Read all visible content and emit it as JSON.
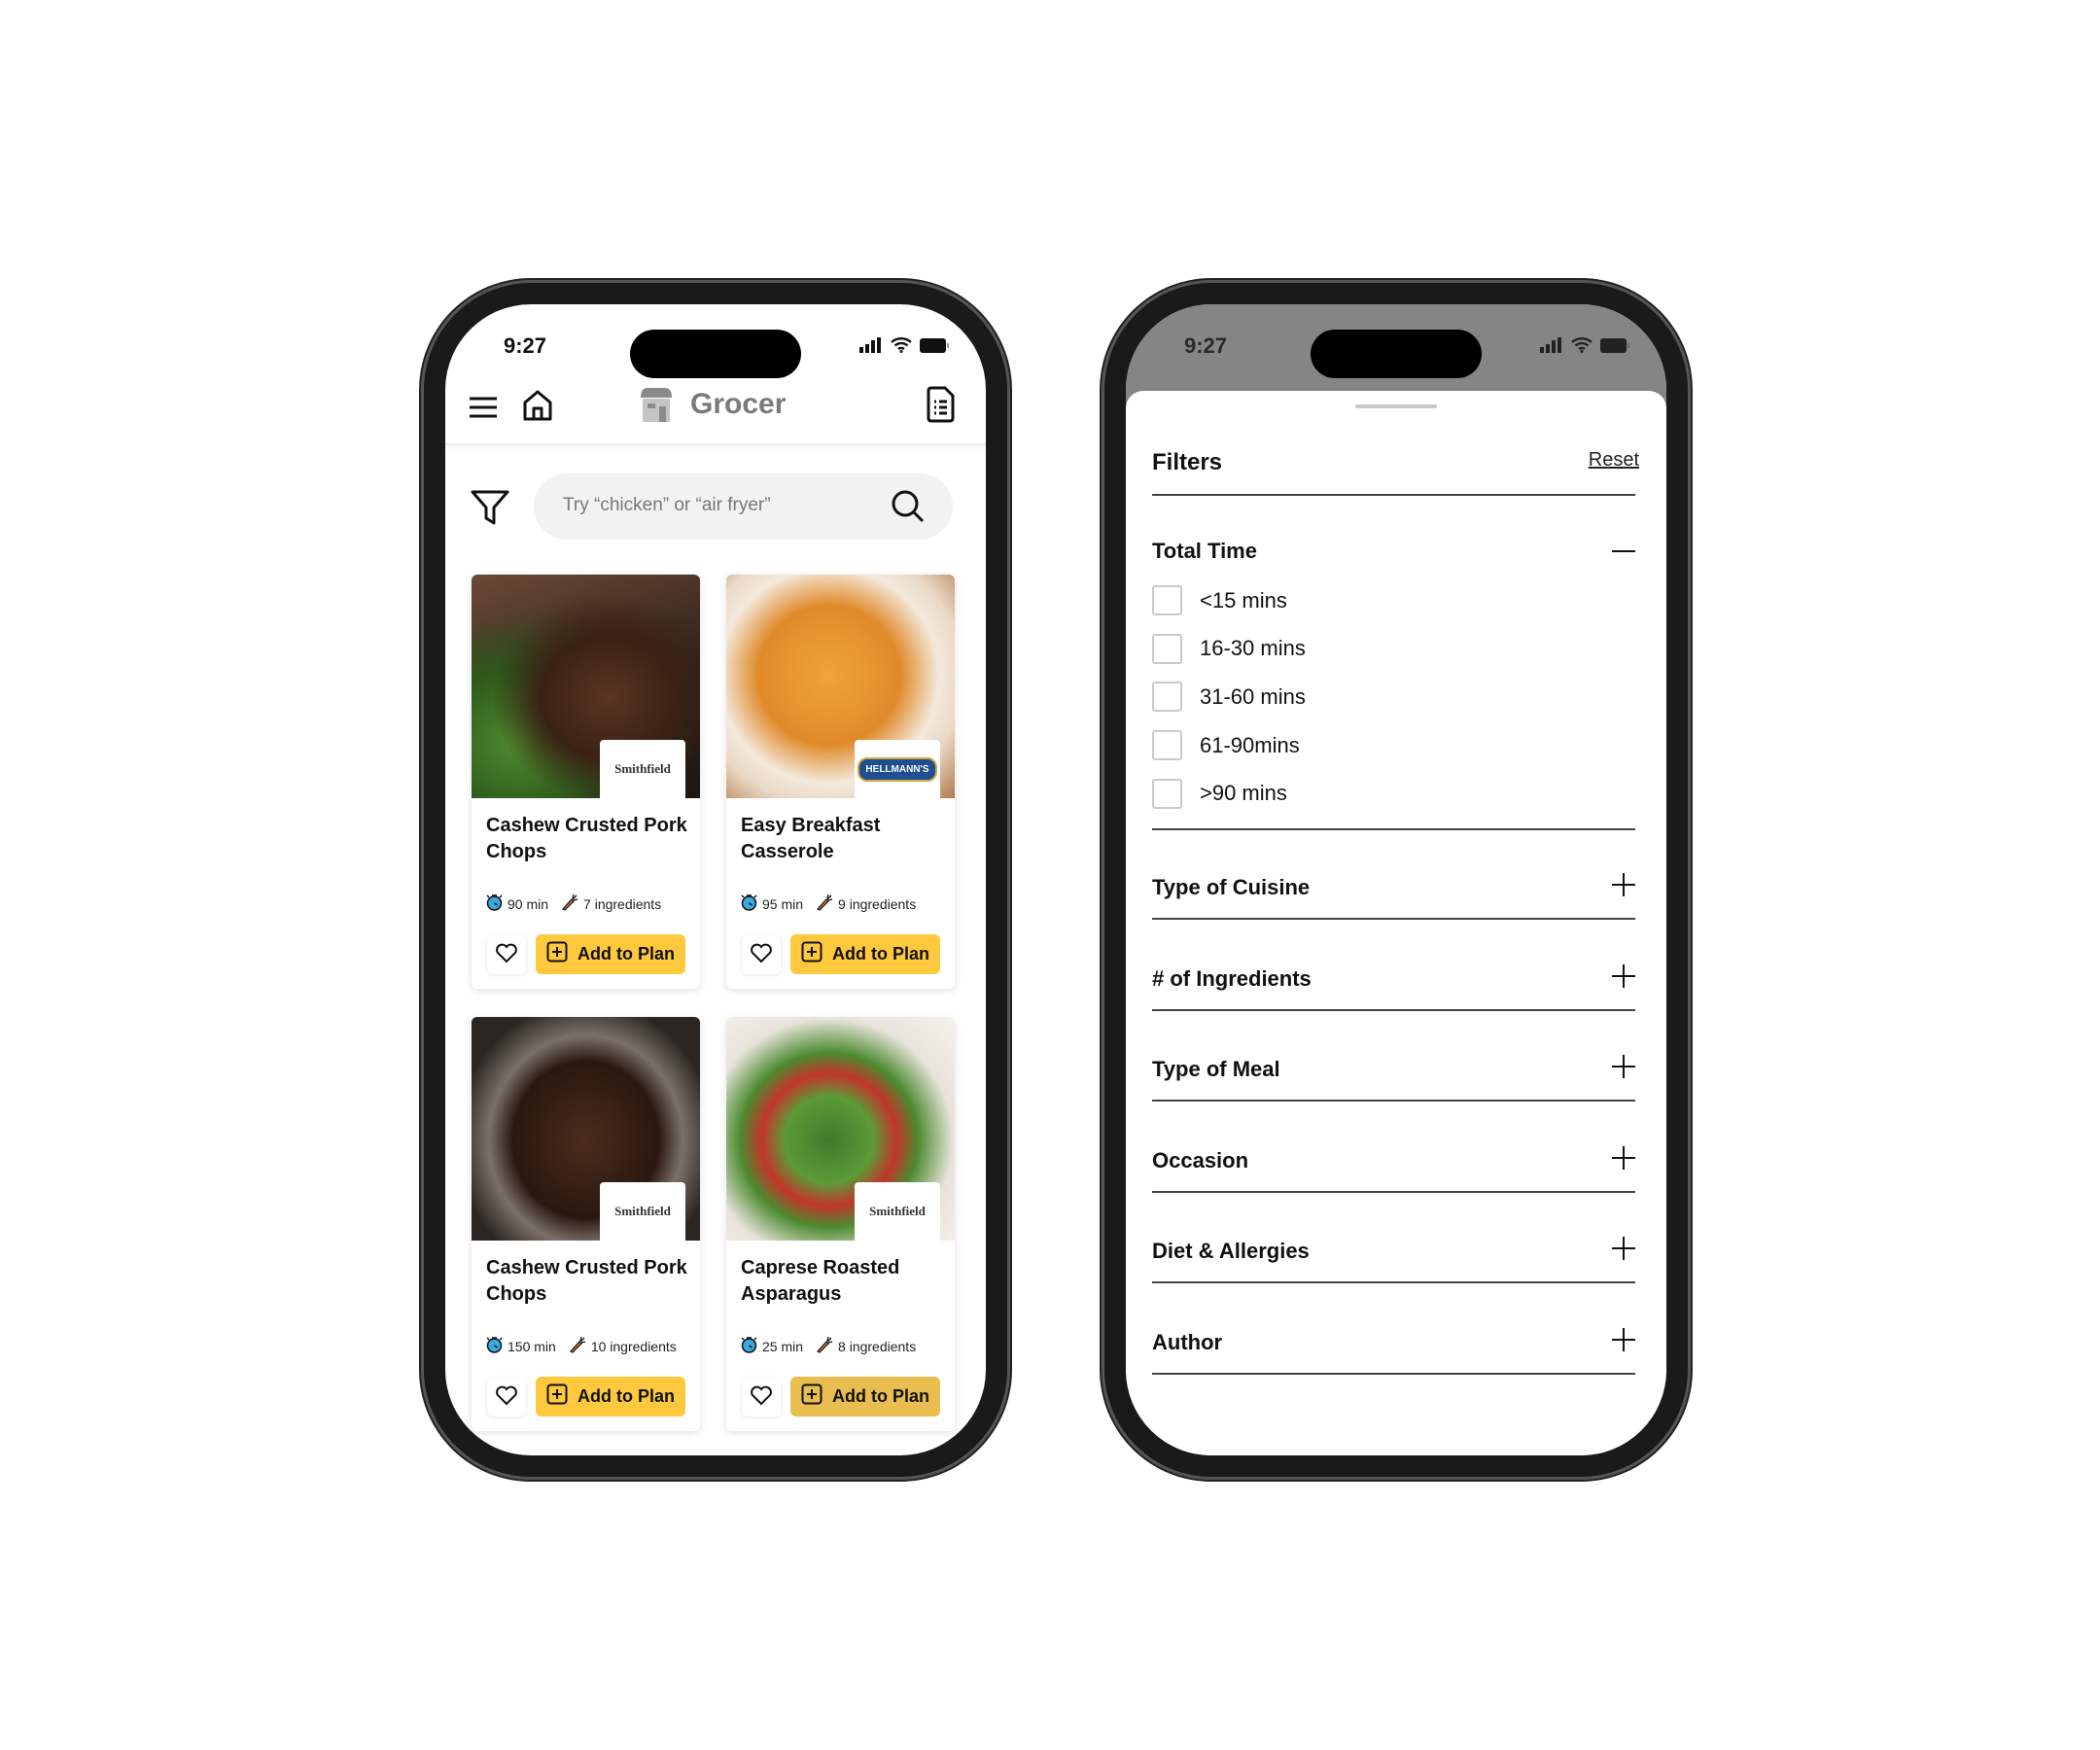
{
  "status": {
    "time": "9:27"
  },
  "app": {
    "name": "Grocer",
    "icons": [
      "hamburger-menu-icon",
      "home-icon",
      "store-logo-icon",
      "list-document-icon"
    ]
  },
  "search": {
    "placeholder": "Try “chicken” or “air fryer”"
  },
  "colors": {
    "accent": "#FFC83D",
    "timer": "#3AA7E0",
    "carrot": "#E8743B",
    "dim_overlay": "#858585"
  },
  "recipes": [
    {
      "title": "Cashew Crusted Pork Chops",
      "brand": "Smithfield",
      "time": "90 min",
      "ingredients": "7 ingredients",
      "add_label": "Add to Plan",
      "image": "pork-chops"
    },
    {
      "title": "Easy Breakfast Casserole",
      "brand": "HELLMANN'S",
      "time": "95 min",
      "ingredients": "9 ingredients",
      "add_label": "Add to Plan",
      "image": "casserole"
    },
    {
      "title": "Cashew Crusted Pork Chops",
      "brand": "Smithfield",
      "time": "150 min",
      "ingredients": "10 ingredients",
      "add_label": "Add to Plan",
      "image": "steak"
    },
    {
      "title": "Caprese Roasted Asparagus",
      "brand": "Smithfield",
      "time": "25 min",
      "ingredients": "8 ingredients",
      "add_label": "Add to Plan",
      "image": "asparagus"
    }
  ],
  "filters": {
    "title": "Filters",
    "reset_label": "Reset",
    "total_time": {
      "label": "Total Time",
      "expanded": true,
      "options": [
        "<15 mins",
        "16-30 mins",
        "31-60 mins",
        "61-90mins",
        ">90 mins"
      ]
    },
    "sections": [
      "Type of Cuisine",
      "# of Ingredients",
      "Type of Meal",
      "Occasion",
      "Diet & Allergies",
      "Author"
    ]
  }
}
